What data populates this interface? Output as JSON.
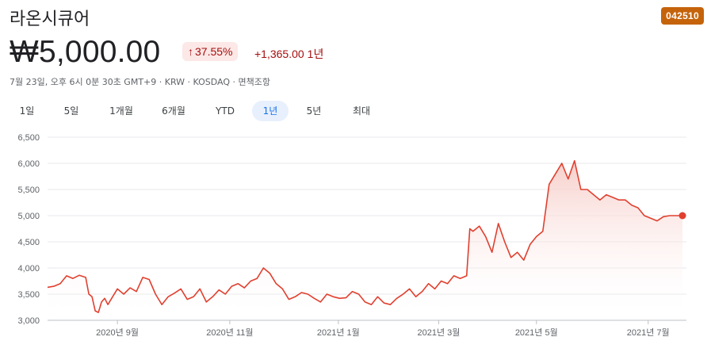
{
  "header": {
    "company_name": "라온시큐어",
    "ticker_badge": "042510",
    "price": "₩5,000.00",
    "change_pct": "37.55%",
    "change_arrow": "↑",
    "change_abs": "+1,365.00",
    "change_period": "1년",
    "meta": "7월 23일, 오후 6시 0분 30초 GMT+9 · KRW · KOSDAQ · 면책조항"
  },
  "tabs": [
    {
      "label": "1일",
      "active": false
    },
    {
      "label": "5일",
      "active": false
    },
    {
      "label": "1개월",
      "active": false
    },
    {
      "label": "6개월",
      "active": false
    },
    {
      "label": "YTD",
      "active": false
    },
    {
      "label": "1년",
      "active": true
    },
    {
      "label": "5년",
      "active": false
    },
    {
      "label": "최대",
      "active": false
    }
  ],
  "colors": {
    "line": "#e0402f",
    "fill_top": "#f6c9c4",
    "grid": "#e8eaed",
    "badge": "#c5630b"
  },
  "chart_data": {
    "type": "area",
    "y_ticks": [
      3000,
      3500,
      4000,
      4500,
      5000,
      5500,
      6000,
      6500
    ],
    "y_tick_labels": [
      "3,000",
      "3,500",
      "4,000",
      "4,500",
      "5,000",
      "5,500",
      "6,000",
      "6,500"
    ],
    "ylim": [
      3000,
      6700
    ],
    "x_tick_labels": [
      "2020년 9월",
      "2020년 11월",
      "2021년 1월",
      "2021년 3월",
      "2021년 5월",
      "2021년 7월"
    ],
    "x_tick_positions": [
      0.11,
      0.287,
      0.458,
      0.616,
      0.77,
      0.946
    ],
    "grid": true,
    "x": [
      0.0,
      0.01,
      0.02,
      0.03,
      0.04,
      0.05,
      0.06,
      0.065,
      0.07,
      0.075,
      0.08,
      0.085,
      0.09,
      0.095,
      0.1,
      0.11,
      0.12,
      0.13,
      0.14,
      0.15,
      0.16,
      0.17,
      0.18,
      0.19,
      0.2,
      0.21,
      0.22,
      0.23,
      0.24,
      0.25,
      0.26,
      0.27,
      0.28,
      0.29,
      0.3,
      0.31,
      0.32,
      0.33,
      0.34,
      0.35,
      0.36,
      0.37,
      0.38,
      0.39,
      0.4,
      0.41,
      0.42,
      0.43,
      0.44,
      0.45,
      0.46,
      0.47,
      0.48,
      0.49,
      0.5,
      0.51,
      0.52,
      0.53,
      0.54,
      0.55,
      0.56,
      0.57,
      0.58,
      0.59,
      0.6,
      0.61,
      0.62,
      0.63,
      0.64,
      0.65,
      0.66,
      0.665,
      0.67,
      0.68,
      0.69,
      0.7,
      0.71,
      0.72,
      0.73,
      0.74,
      0.75,
      0.76,
      0.77,
      0.78,
      0.79,
      0.8,
      0.81,
      0.82,
      0.83,
      0.84,
      0.85,
      0.86,
      0.87,
      0.88,
      0.89,
      0.9,
      0.91,
      0.92,
      0.93,
      0.94,
      0.95,
      0.96,
      0.97,
      0.98,
      0.99,
      1.0
    ],
    "values": [
      3630,
      3650,
      3700,
      3850,
      3800,
      3860,
      3820,
      3500,
      3450,
      3180,
      3150,
      3350,
      3420,
      3300,
      3400,
      3600,
      3500,
      3620,
      3550,
      3820,
      3780,
      3500,
      3300,
      3450,
      3520,
      3600,
      3400,
      3450,
      3600,
      3350,
      3450,
      3580,
      3500,
      3650,
      3700,
      3620,
      3750,
      3800,
      4000,
      3900,
      3700,
      3600,
      3400,
      3450,
      3530,
      3500,
      3420,
      3350,
      3500,
      3450,
      3420,
      3430,
      3550,
      3500,
      3350,
      3300,
      3450,
      3330,
      3300,
      3420,
      3500,
      3600,
      3450,
      3550,
      3700,
      3600,
      3750,
      3700,
      3850,
      3800,
      3850,
      4750,
      4700,
      4800,
      4600,
      4300,
      4850,
      4500,
      4200,
      4300,
      4150,
      4450,
      4600,
      4700,
      5600,
      5800,
      6000,
      5700,
      6050,
      5500,
      5500,
      5400,
      5300,
      5400,
      5350,
      5300,
      5300,
      5200,
      5150,
      5000,
      4950,
      4900,
      4980,
      5000,
      5000,
      5000
    ],
    "last_value": 5000
  }
}
